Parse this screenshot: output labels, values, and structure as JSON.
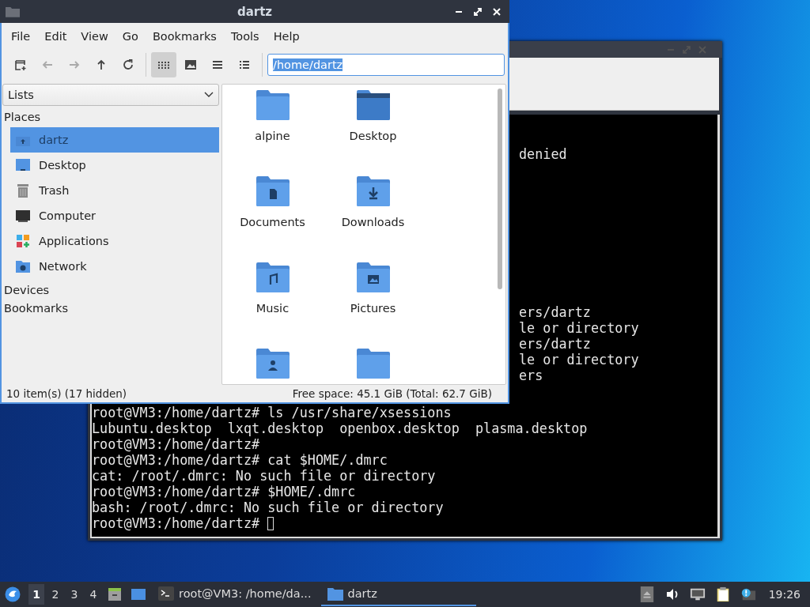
{
  "terminal": {
    "top_fragments": [
      "denied"
    ],
    "middle_fragments": [
      "ers/dartz",
      "le or directory",
      "ers/dartz",
      "le or directory",
      "ers"
    ],
    "lines": [
      "root@VM3:/home/dartz# ls /usr/share/xsessions",
      "Lubuntu.desktop  lxqt.desktop  openbox.desktop  plasma.desktop",
      "root@VM3:/home/dartz#",
      "root@VM3:/home/dartz# cat $HOME/.dmrc",
      "cat: /root/.dmrc: No such file or directory",
      "root@VM3:/home/dartz# $HOME/.dmrc",
      "bash: /root/.dmrc: No such file or directory",
      "root@VM3:/home/dartz# "
    ]
  },
  "file_manager": {
    "title": "dartz",
    "menu": [
      "File",
      "Edit",
      "View",
      "Go",
      "Bookmarks",
      "Tools",
      "Help"
    ],
    "nav_buttons": [
      {
        "disabled": false
      },
      {
        "disabled": true
      },
      {
        "disabled": true
      },
      {
        "disabled": false
      },
      {
        "disabled": false
      }
    ],
    "view_buttons": [
      {
        "selected": true
      },
      {
        "selected": false
      },
      {
        "selected": false
      },
      {
        "selected": false
      }
    ],
    "path": "/home/dartz",
    "sidebar": {
      "mode": "Lists",
      "sections": [
        {
          "title": "Places",
          "items": [
            {
              "label": "dartz",
              "selected": true
            },
            {
              "label": "Desktop",
              "selected": false
            },
            {
              "label": "Trash",
              "selected": false
            },
            {
              "label": "Computer",
              "selected": false
            },
            {
              "label": "Applications",
              "selected": false
            },
            {
              "label": "Network",
              "selected": false
            }
          ]
        },
        {
          "title": "Devices"
        },
        {
          "title": "Bookmarks"
        }
      ]
    },
    "files": [
      {
        "name": "alpine"
      },
      {
        "name": "Desktop"
      },
      {
        "name": "Documents"
      },
      {
        "name": "Downloads"
      },
      {
        "name": "Music"
      },
      {
        "name": "Pictures"
      }
    ],
    "status_left": "10 item(s) (17 hidden)",
    "status_right": "Free space: 45.1 GiB (Total: 62.7 GiB)"
  },
  "taskbar": {
    "workspaces": [
      {
        "label": "1",
        "selected": true
      },
      {
        "label": "2",
        "selected": false
      },
      {
        "label": "3",
        "selected": false
      },
      {
        "label": "4",
        "selected": false
      }
    ],
    "tasks": [
      {
        "label": "root@VM3: /home/da...",
        "selected": false
      },
      {
        "label": "dartz",
        "selected": true
      }
    ],
    "clock": "19:26"
  }
}
